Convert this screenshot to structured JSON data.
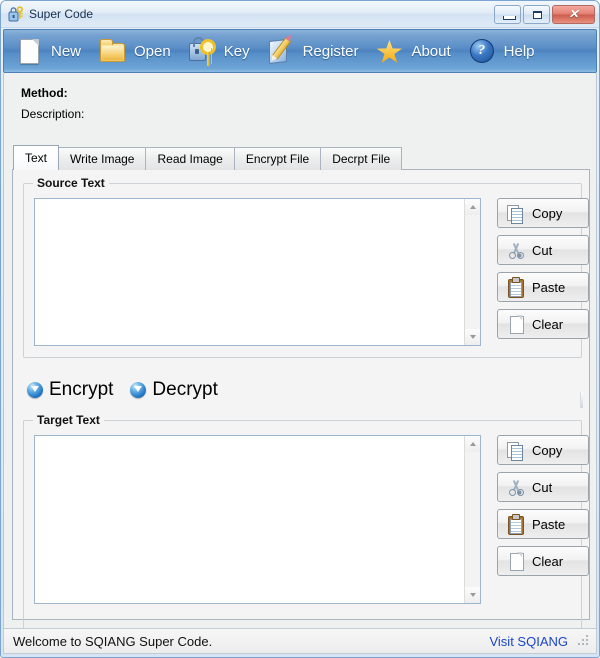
{
  "window": {
    "title": "Super Code",
    "icon": "lock-key-icon",
    "controls": {
      "minimize": "Minimize",
      "maximize": "Maximize",
      "close": "✕"
    }
  },
  "toolbar": {
    "items": [
      {
        "label": "New",
        "icon": "new-page-icon"
      },
      {
        "label": "Open",
        "icon": "open-folder-icon"
      },
      {
        "label": "Key",
        "icon": "lock-key-icon"
      },
      {
        "label": "Register",
        "icon": "register-pencil-icon"
      },
      {
        "label": "About",
        "icon": "star-icon"
      },
      {
        "label": "Help",
        "icon": "question-help-icon"
      }
    ]
  },
  "header": {
    "method_label": "Method:",
    "method_value": "",
    "description_label": "Description:",
    "description_value": ""
  },
  "tabs": [
    {
      "label": "Text",
      "active": true
    },
    {
      "label": "Write Image",
      "active": false
    },
    {
      "label": "Read Image",
      "active": false
    },
    {
      "label": "Encrypt File",
      "active": false
    },
    {
      "label": "Decrpt File",
      "active": false
    }
  ],
  "source_group": {
    "title": "Source Text",
    "text": "",
    "placeholder": "",
    "buttons": [
      {
        "label": "Copy",
        "icon": "copy-icon"
      },
      {
        "label": "Cut",
        "icon": "scissors-icon"
      },
      {
        "label": "Paste",
        "icon": "clipboard-icon"
      },
      {
        "label": "Clear",
        "icon": "blank-page-icon"
      }
    ]
  },
  "mode_options": [
    {
      "label": "Encrypt",
      "icon": "blue-down-arrow-icon"
    },
    {
      "label": "Decrypt",
      "icon": "blue-down-arrow-icon"
    }
  ],
  "target_group": {
    "title": "Target Text",
    "text": "",
    "placeholder": "",
    "buttons": [
      {
        "label": "Copy",
        "icon": "copy-icon"
      },
      {
        "label": "Cut",
        "icon": "scissors-icon"
      },
      {
        "label": "Paste",
        "icon": "clipboard-icon"
      },
      {
        "label": "Clear",
        "icon": "blank-page-icon"
      }
    ]
  },
  "status_bar": {
    "message": "Welcome to SQIANG Super Code.",
    "link": "Visit SQIANG"
  },
  "colors": {
    "toolbar_blue": "#5289c5",
    "link_blue": "#1a46c8",
    "window_border": "#7ba5d0",
    "panel_bg": "#f4f4f4"
  }
}
